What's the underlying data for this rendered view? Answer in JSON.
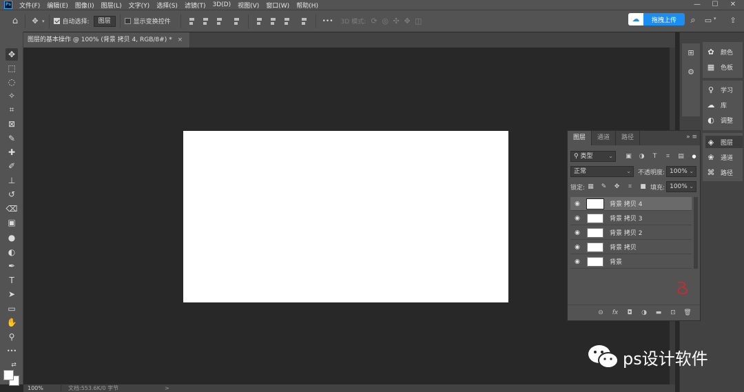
{
  "app": {
    "logo_text": "Ps",
    "menu": [
      "文件(F)",
      "编辑(E)",
      "图像(I)",
      "图层(L)",
      "文字(Y)",
      "选择(S)",
      "滤镜(T)",
      "3D(D)",
      "视图(V)",
      "窗口(W)",
      "帮助(H)"
    ],
    "window_controls": {
      "minimize": "—",
      "maximize": "☐",
      "close": "✕"
    }
  },
  "options_bar": {
    "home_icon": "⌂",
    "move_icon": "✥",
    "auto_select_label": "自动选择:",
    "auto_select_value": "图层",
    "show_transform_label": "显示变换控件",
    "more_icon": "•••",
    "mode_3d_label": "3D 模式:",
    "upload_logo": "☁",
    "upload_label": "拖拽上传",
    "search_icon": "⌕",
    "workspace_icon": "▭",
    "share_icon": "⇪"
  },
  "document": {
    "tab_title": "图层的基本操作 @ 100% (背景 拷贝 4, RGB/8#) *",
    "tab_close": "×",
    "canvas_color": "#ffffff"
  },
  "status_bar": {
    "zoom": "100%",
    "doc_info": "文档:553.6K/0 字节",
    "arrow": ">"
  },
  "tools": [
    {
      "name": "move-tool",
      "glyph": "✥",
      "active": true
    },
    {
      "name": "marquee-tool",
      "glyph": "⬚"
    },
    {
      "name": "lasso-tool",
      "glyph": "◌"
    },
    {
      "name": "magic-wand-tool",
      "glyph": "✧"
    },
    {
      "name": "crop-tool",
      "glyph": "⌗"
    },
    {
      "name": "frame-tool",
      "glyph": "⊠"
    },
    {
      "name": "eyedropper-tool",
      "glyph": "✎"
    },
    {
      "name": "healing-brush-tool",
      "glyph": "✚"
    },
    {
      "name": "brush-tool",
      "glyph": "✐"
    },
    {
      "name": "clone-stamp-tool",
      "glyph": "⊥"
    },
    {
      "name": "history-brush-tool",
      "glyph": "↺"
    },
    {
      "name": "eraser-tool",
      "glyph": "⌫"
    },
    {
      "name": "gradient-tool",
      "glyph": "▣"
    },
    {
      "name": "blur-tool",
      "glyph": "●"
    },
    {
      "name": "dodge-tool",
      "glyph": "◐"
    },
    {
      "name": "pen-tool",
      "glyph": "✒"
    },
    {
      "name": "type-tool",
      "glyph": "T"
    },
    {
      "name": "path-selection-tool",
      "glyph": "➤"
    },
    {
      "name": "rectangle-tool",
      "glyph": "▭"
    },
    {
      "name": "hand-tool",
      "glyph": "✋"
    },
    {
      "name": "zoom-tool",
      "glyph": "⚲"
    },
    {
      "name": "more-tools",
      "glyph": "•••"
    },
    {
      "name": "swap-colors",
      "glyph": "⇄"
    }
  ],
  "right_strip": {
    "history_icon": "⊞",
    "properties_icon": "⚙"
  },
  "panels": {
    "color": "颜色",
    "swatches": "色板",
    "learn": "学习",
    "library": "库",
    "adjustments": "调整",
    "layers": "图层",
    "channels": "通道",
    "paths": "路径"
  },
  "layers_panel": {
    "tabs": [
      "图层",
      "通道",
      "路径"
    ],
    "menu_icons": "»  ≡",
    "filter_label": "类型",
    "blend_mode": "正常",
    "opacity_label": "不透明度:",
    "opacity_value": "100%",
    "lock_label": "锁定:",
    "fill_label": "填充:",
    "fill_value": "100%",
    "layers": [
      {
        "name": "背景 拷贝 4",
        "selected": true
      },
      {
        "name": "背景 拷贝 3",
        "selected": false
      },
      {
        "name": "背景 拷贝 2",
        "selected": false
      },
      {
        "name": "背景 拷贝",
        "selected": false
      },
      {
        "name": "背景",
        "selected": false
      }
    ],
    "bottom_icons": [
      "⊝",
      "fx",
      "◘",
      "◑",
      "▬",
      "⊡",
      "🗑"
    ]
  },
  "watermark": {
    "text": "ps设计软件"
  },
  "colors": {
    "accent_blue": "#1a8ef2",
    "ui_dark": "#535353",
    "canvas_bg": "#282828"
  }
}
